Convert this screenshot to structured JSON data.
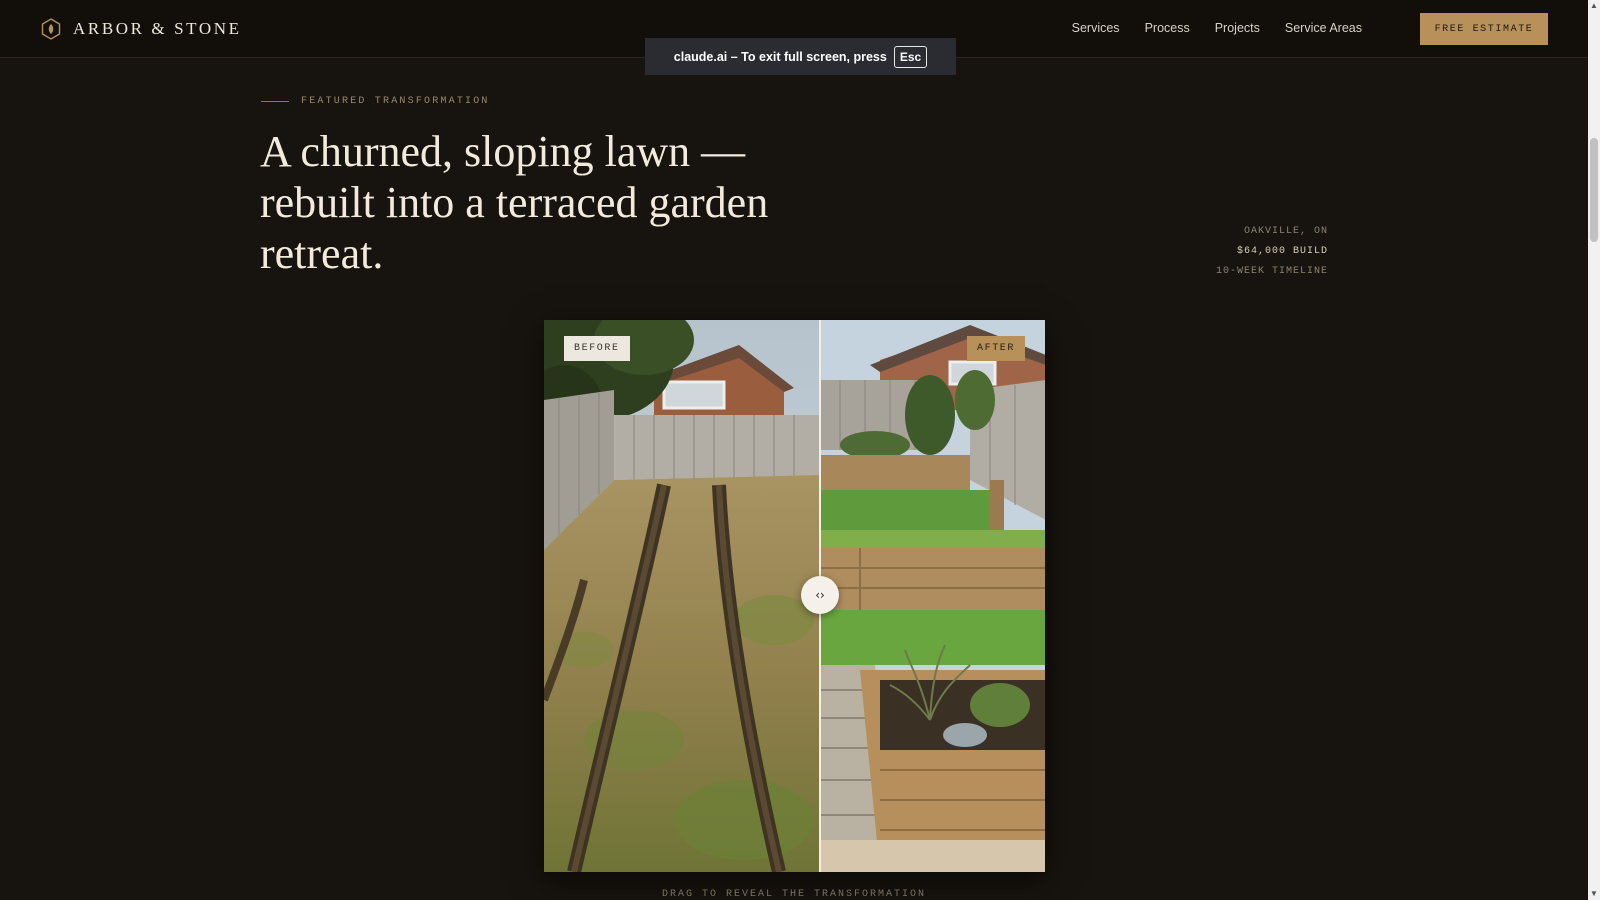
{
  "header": {
    "brand": "ARBOR & STONE",
    "logo_icon": "hexagon-leaf-icon",
    "nav": [
      {
        "label": "Services"
      },
      {
        "label": "Process"
      },
      {
        "label": "Projects"
      },
      {
        "label": "Service Areas"
      }
    ],
    "cta_label": "FREE ESTIMATE"
  },
  "fullscreen_notice": {
    "text": "claude.ai – To exit full screen, press",
    "key": "Esc"
  },
  "hero": {
    "eyebrow": "FEATURED TRANSFORMATION",
    "headline": "A churned, sloping lawn — rebuilt into a terraced garden retreat.",
    "meta": {
      "location": "OAKVILLE, ON",
      "budget": "$64,000 BUILD",
      "timeline": "10-WEEK TIMELINE"
    }
  },
  "comparison": {
    "before_label": "BEFORE",
    "after_label": "AFTER",
    "handle_glyph": "‹›",
    "handle_icon": "chevrons-left-right-icon",
    "split_fraction": 0.55,
    "caption": "DRAG TO REVEAL THE TRANSFORMATION"
  },
  "colors": {
    "background": "#17130e",
    "accent": "#b8915a"
  }
}
